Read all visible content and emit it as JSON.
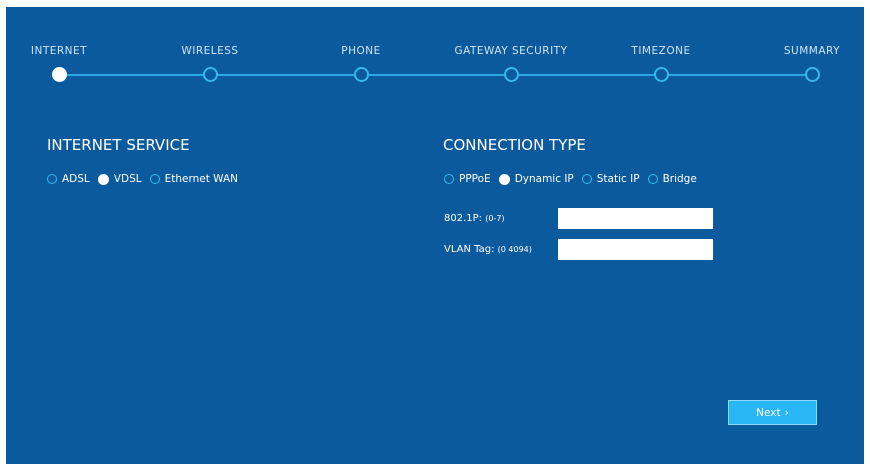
{
  "stepper": {
    "steps": [
      {
        "label": "INTERNET",
        "active": true
      },
      {
        "label": "WIRELESS",
        "active": false
      },
      {
        "label": "PHONE",
        "active": false
      },
      {
        "label": "GATEWAY SECURITY",
        "active": false
      },
      {
        "label": "TIMEZONE",
        "active": false
      },
      {
        "label": "SUMMARY",
        "active": false
      }
    ]
  },
  "internet_service": {
    "title": "INTERNET SERVICE",
    "options": [
      "ADSL",
      "VDSL",
      "Ethernet WAN"
    ],
    "selected": "VDSL"
  },
  "connection_type": {
    "title": "CONNECTION TYPE",
    "options": [
      "PPPoE",
      "Dynamic IP",
      "Static IP",
      "Bridge"
    ],
    "selected": "Dynamic IP"
  },
  "fields": {
    "priority_label": "802.1P:",
    "priority_hint": "(0-7)",
    "priority_value": "",
    "vlan_label": "VLAN Tag:",
    "vlan_hint": "(0 4094)",
    "vlan_value": ""
  },
  "next_button": {
    "label": "Next",
    "chevron": "›"
  },
  "colors": {
    "background": "#0b5a9e",
    "accent": "#29b6f6",
    "step_line": "#2aa9e4"
  }
}
